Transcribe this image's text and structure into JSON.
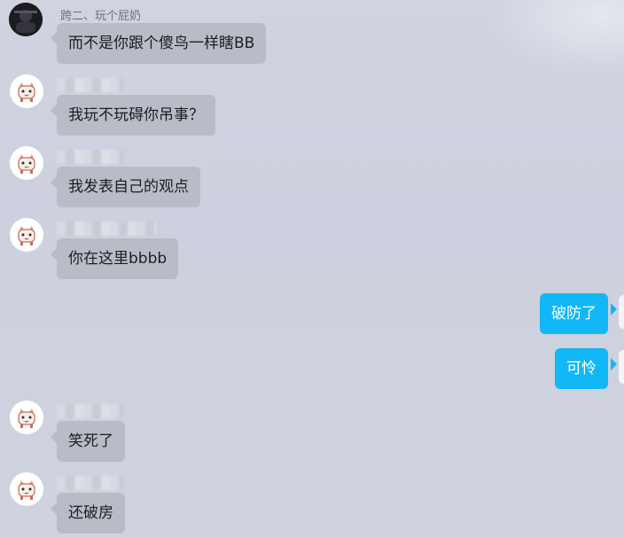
{
  "chat": {
    "messages": [
      {
        "sender": "跨二、玩个屁奶",
        "text": "而不是你跟个傻鸟一样瞎BB"
      },
      {
        "sender": "",
        "text": "我玩不玩碍你吊事？"
      },
      {
        "sender": "",
        "text": "我发表自己的观点"
      },
      {
        "sender": "",
        "text": "你在这里bbbb"
      },
      {
        "sender": "me",
        "text": "破防了"
      },
      {
        "sender": "me",
        "text": "可怜"
      },
      {
        "sender": "",
        "text": "笑死了"
      },
      {
        "sender": "",
        "text": "还破房"
      }
    ]
  },
  "colors": {
    "background": "#cfd2df",
    "incoming_bubble": "#b9bbc6",
    "outgoing_bubble": "#12b7f5"
  },
  "icons": {
    "first_sender_avatar": "dark-photo-avatar",
    "other_sender_avatar": "cartoon-cat-avatar",
    "self_avatar": "self-avatar"
  }
}
